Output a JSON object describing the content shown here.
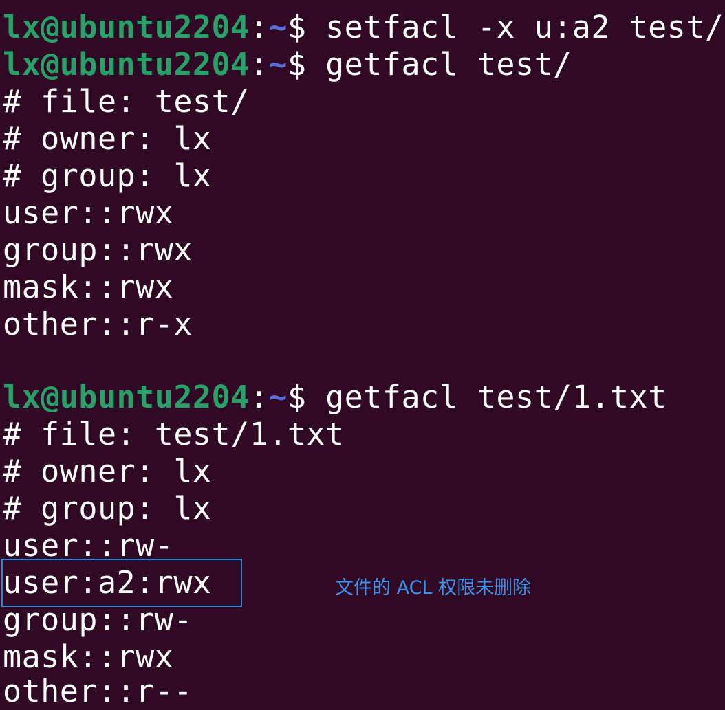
{
  "prompt": {
    "user_host": "lx@ubuntu2204",
    "colon": ":",
    "path": "~",
    "dollar": "$"
  },
  "commands": [
    " setfacl -x u:a2 test/",
    " getfacl test/",
    " getfacl test/1.txt"
  ],
  "output_block_1": [
    "# file: test/",
    "# owner: lx",
    "# group: lx",
    "user::rwx",
    "group::rwx",
    "mask::rwx",
    "other::r-x"
  ],
  "output_block_2": [
    "# file: test/1.txt",
    "# owner: lx",
    "# group: lx",
    "user::rw-",
    "user:a2:rwx",
    "group::rw-",
    "mask::rwx",
    "other::r--"
  ],
  "annotation": {
    "text": "文件的 ACL 权限未删除",
    "color": "#3c92e8",
    "box_color": "#2f86d6"
  },
  "colors": {
    "background": "#300a24",
    "user_host": "#26a269",
    "path": "#5a6fd6",
    "text": "#ffffff"
  }
}
